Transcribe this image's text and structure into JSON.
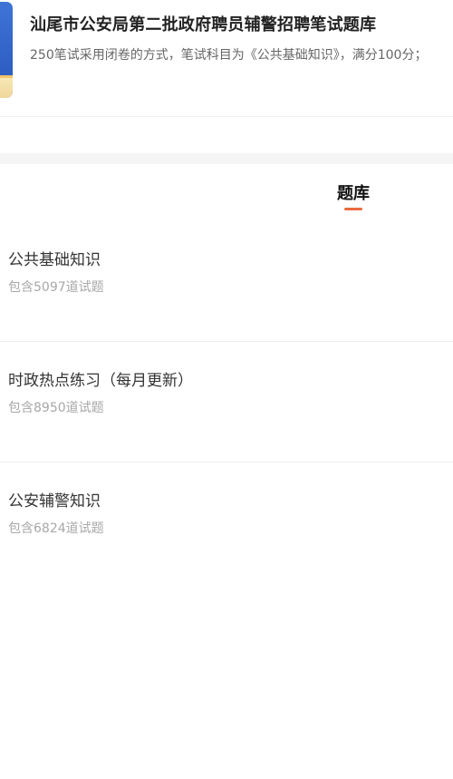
{
  "header": {
    "title": "汕尾市公安局第二批政府聘员辅警招聘笔试题库",
    "description": "250笔试采用闭卷的方式，笔试科目为《公共基础知识》，满分100分；",
    "cover_icon": "book-cover-icon"
  },
  "tabs": [
    {
      "label": "题库",
      "active": true
    }
  ],
  "colors": {
    "accent": "#ec6a3f",
    "cover_blue": "#3f74d6",
    "title": "#222222",
    "muted": "#a8a8a8"
  },
  "question_banks": [
    {
      "name": "公共基础知识",
      "count_text": "包含5097道试题"
    },
    {
      "name": "时政热点练习（每月更新）",
      "count_text": "包含8950道试题"
    },
    {
      "name": "公安辅警知识",
      "count_text": "包含6824道试题"
    }
  ]
}
